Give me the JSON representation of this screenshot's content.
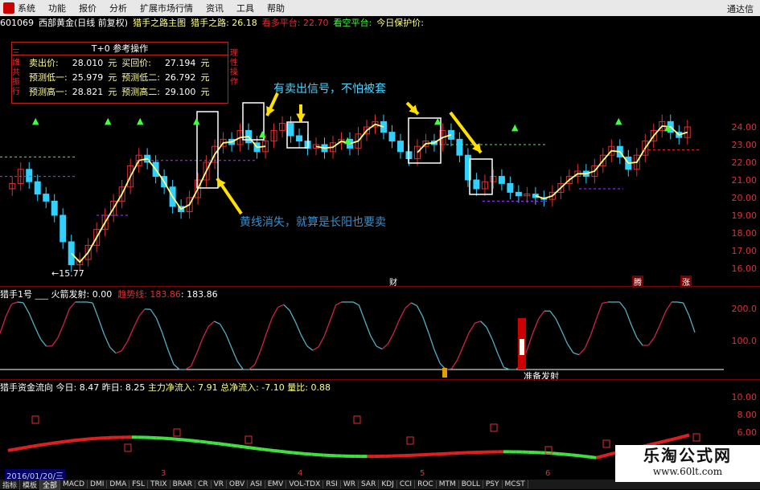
{
  "menu": {
    "items": [
      "系统",
      "功能",
      "报价",
      "分析",
      "扩展市场行情",
      "资讯",
      "工具",
      "帮助"
    ],
    "brand": "通达信"
  },
  "info": {
    "code": "601069",
    "name": "西部黄金(日线 前复权)",
    "indicator": "猎手之路主图",
    "indicator_value": "猎手之路: 26.18",
    "bull_label": "看多平台: 22.70",
    "bear_label": "看空平台:",
    "protect_label": "今日保护价:"
  },
  "tplus": {
    "title": "T+0 参考操作",
    "left_vert": "三维共振行",
    "right_vert": "理性操作",
    "rows": [
      {
        "l1": "卖出价:",
        "v1": "28.010",
        "l2": "买回价:",
        "v2": "27.194"
      },
      {
        "l1": "预测低一:",
        "v1": "25.979",
        "l2": "预测低二:",
        "v2": "26.792"
      },
      {
        "l1": "预测高一:",
        "v1": "28.821",
        "l2": "预测高二:",
        "v2": "29.100"
      }
    ],
    "unit": "元"
  },
  "annotations": {
    "top": "有卖出信号，不怕被套",
    "bottom": "黄线消失，就算是长阳也要卖",
    "low_price": "←15.77",
    "fin_tag1": "财",
    "fin_tag2": "腾",
    "fin_tag3": "涨"
  },
  "price_axis": [
    "24.00",
    "23.00",
    "22.00",
    "21.00",
    "20.00",
    "19.00",
    "18.00",
    "17.00",
    "16.00"
  ],
  "sub1": {
    "title": "猎手1号",
    "fire": "火箭发射: 0.00",
    "trend": "趋势线: 183.86",
    "trend2": ": 183.86",
    "axis": [
      "200.0",
      "100.0"
    ],
    "ready": "准备发射"
  },
  "sub2": {
    "title": "猎手资金流向",
    "today": "今日: 8.47",
    "yest": "昨日: 8.25",
    "main": "主力净流入: 7.91",
    "total": "总净流入: -7.10",
    "ratio": "量比: 0.88",
    "axis": [
      "10.00",
      "8.00",
      "6.00"
    ]
  },
  "datebar": {
    "date": "2016/01/20/三",
    "months": [
      "3",
      "4",
      "5",
      "6"
    ]
  },
  "tabs": [
    "指标",
    "模板",
    "全部",
    "MACD",
    "DMI",
    "DMA",
    "FSL",
    "TRIX",
    "BRAR",
    "CR",
    "VR",
    "OBV",
    "ASI",
    "EMV",
    "VOL-TDX",
    "RSI",
    "WR",
    "SAR",
    "KDJ",
    "CCI",
    "ROC",
    "MTM",
    "BOLL",
    "PSY",
    "MCST"
  ],
  "watermark": {
    "cn": "乐淘公式网",
    "url": "www.60lt.com"
  },
  "colors": {
    "up": "#e03030",
    "down": "#30d0ff",
    "yellow": "#ffff80",
    "green": "#40ff40"
  },
  "chart_data": {
    "type": "candlestick",
    "note_unused": "",
    "closes": [
      20.8,
      21.6,
      20.9,
      20.2,
      19.8,
      19.0,
      17.5,
      16.2,
      16.5,
      17.3,
      18.2,
      19.0,
      19.8,
      20.6,
      21.8,
      22.4,
      22.0,
      21.2,
      20.6,
      19.5,
      19.2,
      20.0,
      21.0,
      22.0,
      22.9,
      23.3,
      23.0,
      23.8,
      23.1,
      22.6,
      23.2,
      23.8,
      24.2,
      23.5,
      23.2,
      22.8,
      23.0,
      22.6,
      23.1,
      23.3,
      22.8,
      23.6,
      24.0,
      24.3,
      23.7,
      23.2,
      22.6,
      22.2,
      22.9,
      23.2,
      23.0,
      23.8,
      23.3,
      22.4,
      21.0,
      20.5,
      20.9,
      21.2,
      20.8,
      20.3,
      20.1,
      20.2,
      20.0,
      19.9,
      20.3,
      20.8,
      21.2,
      21.5,
      21.2,
      21.8,
      22.4,
      22.9,
      22.3,
      21.6,
      22.4,
      23.2,
      23.8,
      24.3,
      23.7,
      23.4,
      24.0
    ]
  }
}
